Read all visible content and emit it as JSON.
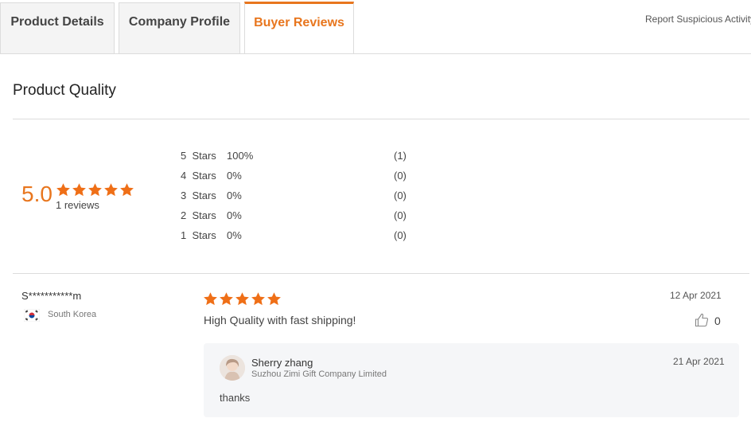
{
  "tabs": [
    {
      "label": "Product Details",
      "active": false
    },
    {
      "label": "Company Profile",
      "active": false
    },
    {
      "label": "Buyer Reviews",
      "active": true
    }
  ],
  "report_link": "Report Suspicious Activity",
  "section_title": "Product Quality",
  "rating": {
    "average": "5.0",
    "stars": 5,
    "reviews_label": "1 reviews",
    "distribution": [
      {
        "stars": "5",
        "label": "Stars",
        "percent": "100%",
        "count": "(1)"
      },
      {
        "stars": "4",
        "label": "Stars",
        "percent": "0%",
        "count": "(0)"
      },
      {
        "stars": "3",
        "label": "Stars",
        "percent": "0%",
        "count": "(0)"
      },
      {
        "stars": "2",
        "label": "Stars",
        "percent": "0%",
        "count": "(0)"
      },
      {
        "stars": "1",
        "label": "Stars",
        "percent": "0%",
        "count": "(0)"
      }
    ]
  },
  "review": {
    "reviewer": "S***********m",
    "country": "South Korea",
    "flag_icon": "south-korea-flag-icon",
    "stars": 5,
    "date": "12 Apr 2021",
    "text": "High Quality with fast shipping!",
    "likes": "0",
    "reply": {
      "name": "Sherry zhang",
      "company": "Suzhou Zimi Gift Company Limited",
      "date": "21 Apr 2021",
      "text": "thanks"
    }
  },
  "colors": {
    "accent": "#e8761e",
    "star": "#ef6f17"
  }
}
